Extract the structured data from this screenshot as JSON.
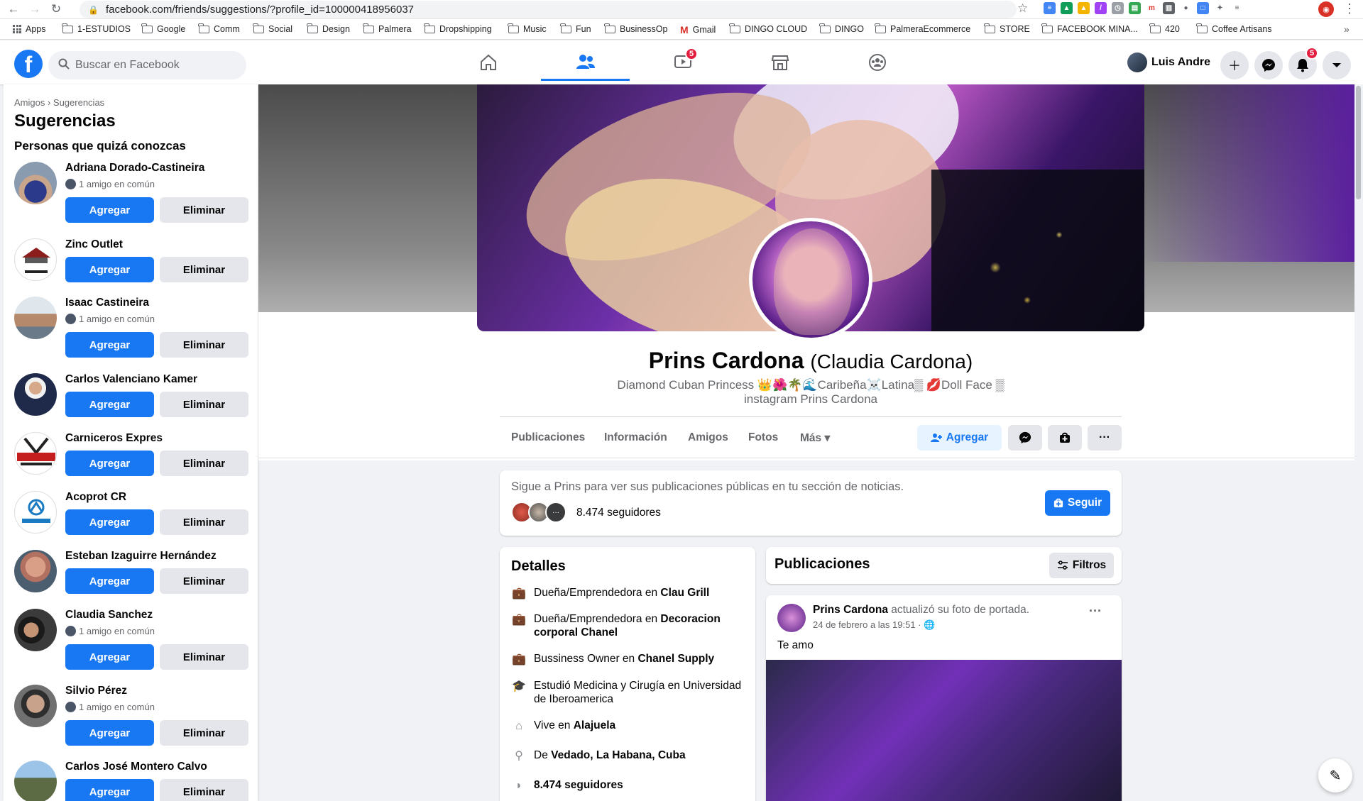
{
  "browser": {
    "url": "facebook.com/friends/suggestions/?profile_id=100000418956037",
    "bookmarks": [
      "Apps",
      "1-ESTUDIOS",
      "Google",
      "Comm",
      "Social",
      "Design",
      "Palmera",
      "Dropshipping",
      "Music",
      "Fun",
      "BusinessOp",
      "Gmail",
      "DINGO CLOUD",
      "DINGO",
      "PalmeraEcommerce",
      "STORE",
      "FACEBOOK MINA...",
      "420",
      "Coffee Artisans"
    ],
    "more": "»"
  },
  "header": {
    "search_placeholder": "Buscar en Facebook",
    "watch_badge": "5",
    "notif_badge": "5",
    "user_name": "Luis Andre"
  },
  "sidebar": {
    "breadcrumb": "Amigos › Sugerencias",
    "title": "Sugerencias",
    "subtitle": "Personas que quizá conozcas",
    "add_label": "Agregar",
    "remove_label": "Eliminar",
    "suggestions": [
      {
        "name": "Adriana Dorado-Castineira",
        "mutual": "1 amigo en común"
      },
      {
        "name": "Zinc Outlet",
        "mutual": ""
      },
      {
        "name": "Isaac Castineira",
        "mutual": "1 amigo en común"
      },
      {
        "name": "Carlos Valenciano Kamer",
        "mutual": ""
      },
      {
        "name": "Carniceros Expres",
        "mutual": ""
      },
      {
        "name": "Acoprot CR",
        "mutual": ""
      },
      {
        "name": "Esteban Izaguirre Hernández",
        "mutual": ""
      },
      {
        "name": "Claudia Sanchez",
        "mutual": "1 amigo en común"
      },
      {
        "name": "Silvio Pérez",
        "mutual": "1 amigo en común"
      },
      {
        "name": "Carlos José Montero Calvo",
        "mutual": ""
      }
    ]
  },
  "profile": {
    "name": "Prins Cardona",
    "alt_name": "(Claudia Cardona)",
    "bio_line1": "Diamond Cuban Princess 👑🌺🌴🌊Caribeña☠️Latina▒ 💋Doll Face ▒",
    "bio_line2": "instagram Prins Cardona",
    "tabs": [
      "Publicaciones",
      "Información",
      "Amigos",
      "Fotos",
      "Más ▾"
    ],
    "add_button": "Agregar"
  },
  "follow": {
    "text": "Sigue a Prins para ver sus publicaciones públicas en tu sección de noticias.",
    "count": "8.474 seguidores",
    "button": "Seguir"
  },
  "details": {
    "title": "Detalles",
    "rows": [
      {
        "pre": "Dueña/Emprendedora en ",
        "bold": "Clau Grill",
        "icon": "briefcase-icon"
      },
      {
        "pre": "Dueña/Emprendedora en ",
        "bold": "Decoracion corporal Chanel",
        "icon": "briefcase-icon"
      },
      {
        "pre": "Bussiness Owner en ",
        "bold": "Chanel Supply",
        "icon": "briefcase-icon"
      },
      {
        "pre": "Estudió Medicina y Cirugía en Universidad de Iberoamerica",
        "bold": "",
        "icon": "graduation-cap-icon"
      },
      {
        "pre": "Vive en ",
        "bold": "Alajuela",
        "icon": "home-icon"
      },
      {
        "pre": "De ",
        "bold": "Vedado, La Habana, Cuba",
        "icon": "location-pin-icon"
      },
      {
        "pre": "",
        "bold": "8.474 seguidores",
        "icon": "rss-icon"
      }
    ]
  },
  "posts": {
    "title": "Publicaciones",
    "filter_button": "Filtros",
    "post": {
      "author": "Prins Cardona",
      "action": " actualizó su foto de portada.",
      "date": "24 de febrero a las 19:51 · 🌐",
      "text": "Te amo",
      "more": "···"
    }
  }
}
